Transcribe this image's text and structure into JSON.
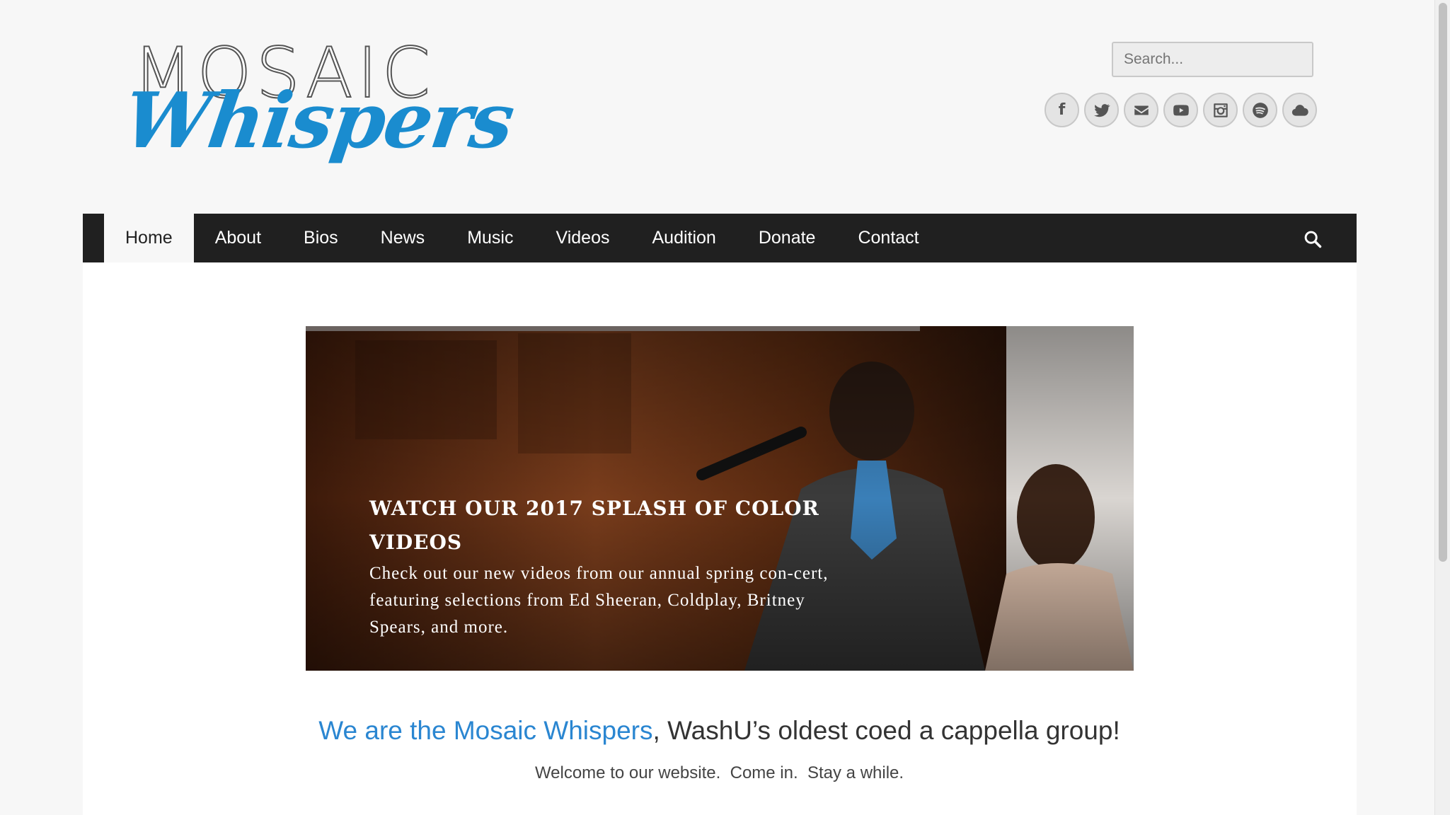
{
  "logo": {
    "top_text": "MOSAIC",
    "bottom_text": "Whispers"
  },
  "search": {
    "placeholder": "Search..."
  },
  "socials": [
    {
      "icon": "facebook-icon",
      "glyph": "f"
    },
    {
      "icon": "twitter-icon"
    },
    {
      "icon": "mail-icon"
    },
    {
      "icon": "youtube-icon"
    },
    {
      "icon": "instagram-icon"
    },
    {
      "icon": "spotify-icon"
    },
    {
      "icon": "cloud-icon"
    }
  ],
  "nav": {
    "items": [
      "Home",
      "About",
      "Bios",
      "News",
      "Music",
      "Videos",
      "Audition",
      "Donate",
      "Contact"
    ],
    "active": "Home"
  },
  "slide": {
    "title": "WATCH OUR 2017 SPLASH OF COLOR VIDEOS",
    "text": "Check out our new videos from our annual spring con-cert, featuring selections from Ed Sheeran, Coldplay, Britney Spears, and more."
  },
  "headline": {
    "accent": "We are the Mosaic Whispers",
    "rest": ", WashU’s oldest coed a cappella group!"
  },
  "subline": "Welcome to our website.  Come in.  Stay a while.",
  "colors": {
    "accent": "#2a86d1",
    "nav_bg": "#202020",
    "logo_blue": "#1a8ccf"
  }
}
